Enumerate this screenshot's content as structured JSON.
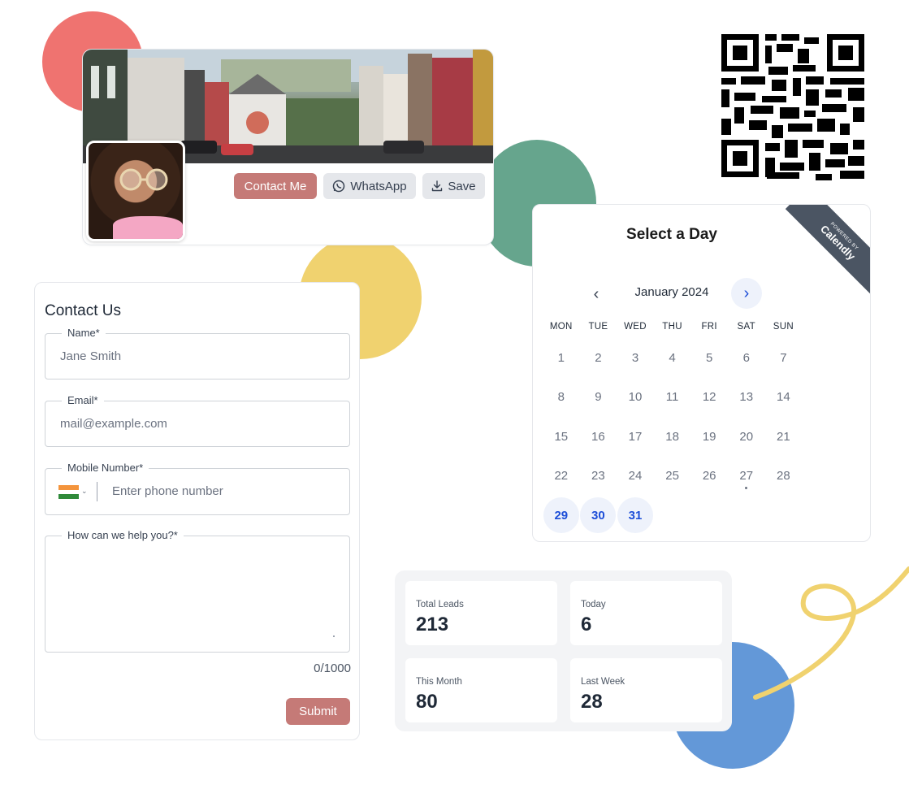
{
  "profile": {
    "contact_label": "Contact Me",
    "whatsapp_label": "WhatsApp",
    "save_label": "Save"
  },
  "calendar": {
    "title": "Select a Day",
    "ribbon_small": "POWERED BY",
    "ribbon_brand": "Calendly",
    "month": "January 2024",
    "weekdays": [
      "MON",
      "TUE",
      "WED",
      "THU",
      "FRI",
      "SAT",
      "SUN"
    ],
    "weeks": [
      [
        "1",
        "2",
        "3",
        "4",
        "5",
        "6",
        "7"
      ],
      [
        "8",
        "9",
        "10",
        "11",
        "12",
        "13",
        "14"
      ],
      [
        "15",
        "16",
        "17",
        "18",
        "19",
        "20",
        "21"
      ],
      [
        "22",
        "23",
        "24",
        "25",
        "26",
        "27",
        "28"
      ],
      [
        "29",
        "30",
        "31",
        "",
        "",
        "",
        ""
      ]
    ],
    "available_days": [
      "29",
      "30",
      "31"
    ],
    "today": "27",
    "accent_color": "#1d4ed8"
  },
  "form": {
    "title": "Contact Us",
    "name_label": "Name*",
    "name_placeholder": "Jane Smith",
    "email_label": "Email*",
    "email_placeholder": "mail@example.com",
    "mobile_label": "Mobile Number*",
    "mobile_placeholder": "Enter phone number",
    "message_label": "How can we help you?*",
    "counter": "0/1000",
    "submit_label": "Submit",
    "accent_color": "#c57a77"
  },
  "stats": [
    {
      "label": "Total Leads",
      "value": "213"
    },
    {
      "label": "Today",
      "value": "6"
    },
    {
      "label": "This Month",
      "value": "80"
    },
    {
      "label": "Last Week",
      "value": "28"
    }
  ]
}
